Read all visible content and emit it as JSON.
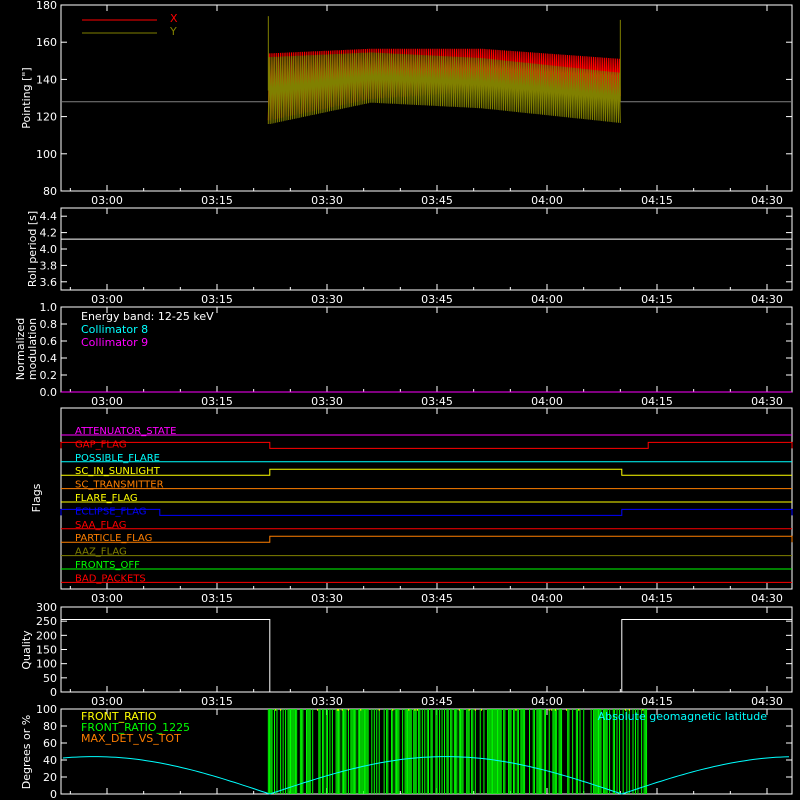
{
  "time_ticks": [
    "03:00",
    "03:15",
    "03:30",
    "03:45",
    "04:00",
    "04:15",
    "04:30"
  ],
  "colors": {
    "x": "#ff0000",
    "y": "#808000",
    "white": "#ffffff",
    "cyan": "#00ffff",
    "magenta": "#ff00ff",
    "green": "#00ff00",
    "orange": "#ff7f00",
    "yellow": "#ffff00",
    "blue": "#0000ff",
    "red": "#ff0000"
  },
  "chart_data": [
    {
      "type": "line",
      "ylabel": "Pointing [\"]",
      "ylim": [
        80,
        180
      ],
      "yticks": [
        "80",
        "100",
        "120",
        "140",
        "160",
        "180"
      ],
      "legend": [
        "X",
        "Y"
      ],
      "baseline_value": 128,
      "data_window": [
        "03:22",
        "04:10"
      ],
      "series": [
        {
          "name": "X",
          "center": [
            [
              3.37,
              136
            ],
            [
              3.6,
              143
            ],
            [
              3.85,
              145
            ],
            [
              4.17,
              141
            ]
          ],
          "amp": [
            [
              3.37,
              36
            ],
            [
              3.6,
              27
            ],
            [
              3.85,
              23
            ],
            [
              4.17,
              20
            ]
          ]
        },
        {
          "name": "Y",
          "center": [
            [
              3.37,
              134
            ],
            [
              3.6,
              141
            ],
            [
              3.85,
              138
            ],
            [
              4.17,
              130
            ]
          ],
          "amp": [
            [
              3.37,
              36
            ],
            [
              3.6,
              27
            ],
            [
              3.85,
              27
            ],
            [
              4.17,
              27
            ]
          ]
        }
      ]
    },
    {
      "type": "line",
      "ylabel": "Roll period [s]",
      "ylim": [
        3.5,
        4.5
      ],
      "yticks": [
        "3.6",
        "3.8",
        "4.0",
        "4.2",
        "4.4"
      ],
      "value": 4.12
    },
    {
      "type": "line",
      "ylabel": "Normalized modulation",
      "ylim": [
        0,
        1
      ],
      "yticks": [
        "0.0",
        "0.2",
        "0.4",
        "0.6",
        "0.8",
        "1.0"
      ],
      "legend": [
        "Energy band: 12-25 keV",
        "Collimator 8",
        "Collimator 9"
      ],
      "value": 0.0
    },
    {
      "type": "line",
      "ylabel": "Flags",
      "flags": [
        {
          "name": "ATTENUATOR_STATE",
          "color": "#ff00ff",
          "on": []
        },
        {
          "name": "GAP_FLAG",
          "color": "#ff0000",
          "on": [
            [
              2.6,
              3.37
            ],
            [
              4.23,
              4.6
            ]
          ]
        },
        {
          "name": "POSSIBLE_FLARE",
          "color": "#00ffff",
          "on": []
        },
        {
          "name": "SC_IN_SUNLIGHT",
          "color": "#ffff00",
          "on": [
            [
              3.37,
              4.17
            ]
          ]
        },
        {
          "name": "SC_TRANSMITTER",
          "color": "#ff7f00",
          "on": []
        },
        {
          "name": "FLARE_FLAG",
          "color": "#ffff00",
          "on": []
        },
        {
          "name": "ECLIPSE_FLAG",
          "color": "#0000ff",
          "on": [
            [
              2.6,
              3.12
            ],
            [
              4.17,
              4.6
            ]
          ]
        },
        {
          "name": "SAA_FLAG",
          "color": "#ff0000",
          "on": []
        },
        {
          "name": "PARTICLE_FLAG",
          "color": "#ff7f00",
          "on": [
            [
              3.37,
              4.6
            ]
          ]
        },
        {
          "name": "AAZ_FLAG",
          "color": "#808000",
          "on": []
        },
        {
          "name": "FRONTS_OFF",
          "color": "#00ff00",
          "on": []
        },
        {
          "name": "BAD_PACKETS",
          "color": "#ff0000",
          "on": []
        }
      ]
    },
    {
      "type": "line",
      "ylabel": "Quality",
      "ylim": [
        0,
        300
      ],
      "yticks": [
        "0",
        "50",
        "100",
        "150",
        "200",
        "250",
        "300"
      ],
      "steps": [
        [
          2.6,
          256
        ],
        [
          3.37,
          0
        ],
        [
          4.17,
          256
        ]
      ]
    },
    {
      "type": "line",
      "ylabel": "Degrees or %",
      "ylim": [
        0,
        100
      ],
      "yticks": [
        "0",
        "20",
        "40",
        "60",
        "80",
        "100"
      ],
      "legend": [
        "FRONT_RATIO",
        "FRONT_RATIO_1225",
        "MAX_DET_VS_TOT"
      ],
      "right_legend": "Absolute geomagnetic latitude",
      "green_window": [
        "03:22",
        "04:14"
      ]
    }
  ]
}
